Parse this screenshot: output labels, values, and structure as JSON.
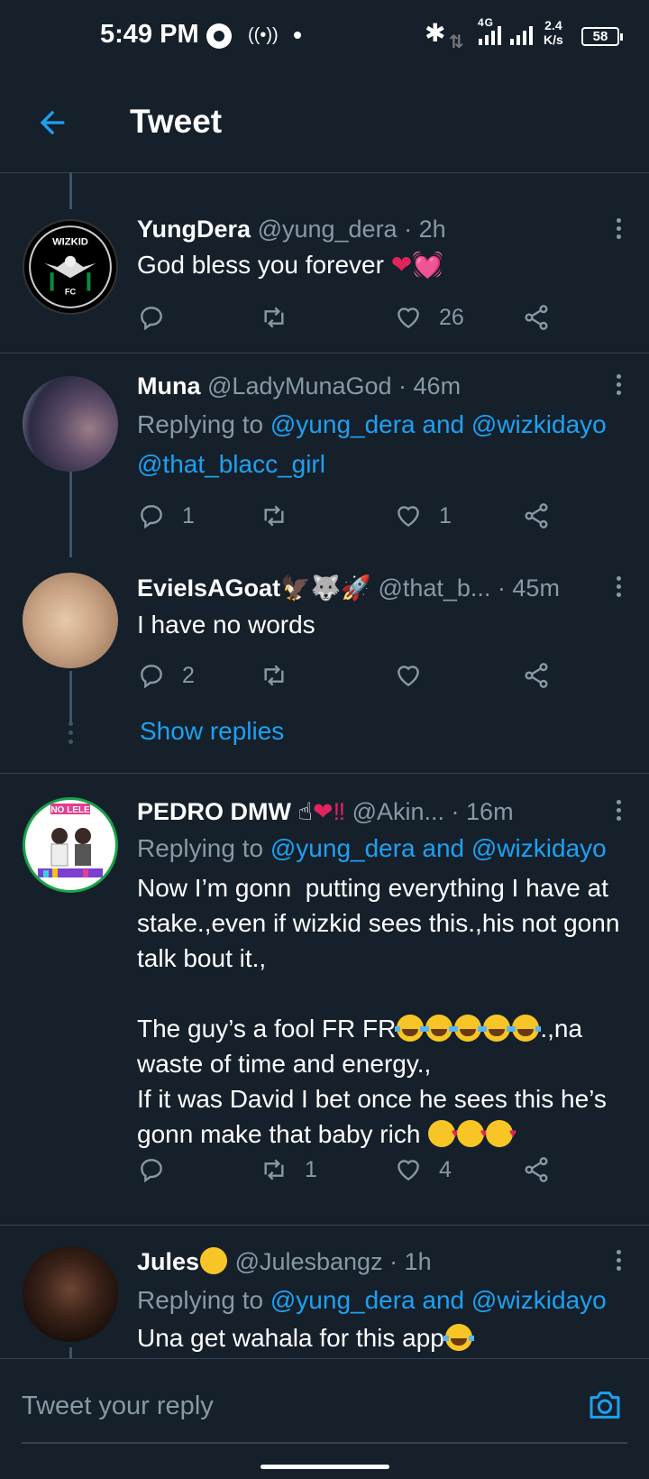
{
  "status_bar": {
    "time": "5:49 PM",
    "network": "4G",
    "speed_value": "2.4",
    "speed_unit": "K/s",
    "battery": "58",
    "icons": [
      "whatsapp-icon",
      "hotspot-icon",
      "bluetooth-icon",
      "data-arrows-icon",
      "signal-icon",
      "battery-icon"
    ]
  },
  "header": {
    "title": "Tweet",
    "back_icon": "arrow-left-icon"
  },
  "tweets": [
    {
      "name": "YungDera",
      "meta": "@yung_dera · 2h",
      "body": "God bless you forever",
      "replies": "",
      "retweets": "",
      "likes": "26"
    },
    {
      "name": "Muna",
      "meta": "@LadyMunaGod · 46m",
      "replying_prefix": "Replying to ",
      "replying_mentions": "@yung_dera and @wizkidayo",
      "replying_line2": "@that_blacc_girl",
      "replies": "1",
      "retweets": "",
      "likes": "1"
    },
    {
      "name": "EvieIsAGoat",
      "meta": "@that_b... · 45m",
      "body": "I have no words",
      "replies": "2",
      "retweets": "",
      "likes": "",
      "show_replies": "Show replies"
    },
    {
      "name": "PEDRO DMW",
      "meta": "@Akin...  · 16m",
      "replying_prefix": "Replying to ",
      "replying_mentions": "@yung_dera and @wizkidayo",
      "body_1": "Now I’m gonn  putting everything I have at stake.,even if wizkid sees this.,his not gonn talk bout it.,",
      "body_2a": "The guy’s a fool FR FR",
      "body_2b": ".,na waste of time and energy.,",
      "body_3": "If it was David I bet once he sees this he’s gonn make that baby rich ",
      "replies": "",
      "retweets": "1",
      "likes": "4"
    },
    {
      "name": "Jules",
      "meta": "@Julesbangz · 1h",
      "replying_prefix": "Replying to ",
      "replying_mentions": "@yung_dera and @wizkidayo",
      "body": "Una get wahala for this app"
    }
  ],
  "composer": {
    "placeholder": "Tweet your reply",
    "camera_icon": "camera-icon"
  },
  "colors": {
    "background": "#15202b",
    "accent": "#1da1f2",
    "muted": "#8899a6",
    "divider": "#38444d",
    "like": "#e0245e"
  }
}
